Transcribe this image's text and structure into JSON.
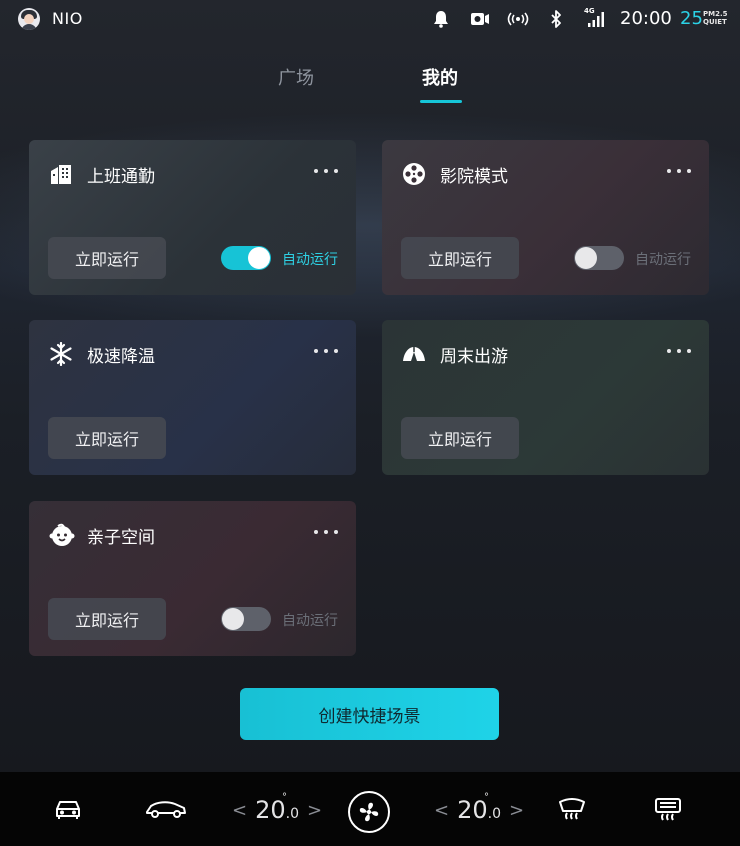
{
  "status_bar": {
    "brand": "NIO",
    "time": "20:00",
    "aqi_value": "25",
    "aqi_label_top": "PM2.5",
    "aqi_label_bottom": "QUIET",
    "network": "4G",
    "icons": [
      "bell-icon",
      "dashcam-icon",
      "hotspot-icon",
      "bluetooth-icon",
      "signal-icon"
    ]
  },
  "tabs": [
    {
      "label": "广场",
      "active": false
    },
    {
      "label": "我的",
      "active": true
    }
  ],
  "scenes": [
    {
      "title": "上班通勤",
      "icon": "building-icon",
      "run_label": "立即运行",
      "has_toggle": true,
      "auto_on": true,
      "auto_label": "自动运行"
    },
    {
      "title": "影院模式",
      "icon": "film-reel-icon",
      "run_label": "立即运行",
      "has_toggle": true,
      "auto_on": false,
      "auto_label": "自动运行"
    },
    {
      "title": "极速降温",
      "icon": "snowflake-icon",
      "run_label": "立即运行",
      "has_toggle": false
    },
    {
      "title": "周末出游",
      "icon": "tent-icon",
      "run_label": "立即运行",
      "has_toggle": false
    },
    {
      "title": "亲子空间",
      "icon": "baby-face-icon",
      "run_label": "立即运行",
      "has_toggle": true,
      "auto_on": false,
      "auto_label": "自动运行"
    }
  ],
  "create_button": "创建快捷场景",
  "bottom_bar": {
    "left_temp": {
      "whole": "20",
      "decimal": ".0",
      "degree": "°"
    },
    "right_temp": {
      "whole": "20",
      "decimal": ".0",
      "degree": "°"
    },
    "arrow_left": "<",
    "arrow_right": ">",
    "icons": [
      "car-icon",
      "car-side-icon",
      "fan-icon",
      "rear-defrost-icon",
      "front-defrost-icon"
    ]
  },
  "colors": {
    "accent": "#17c3d6",
    "toggle_off": "#5e616a",
    "card_button": "#464a52"
  }
}
